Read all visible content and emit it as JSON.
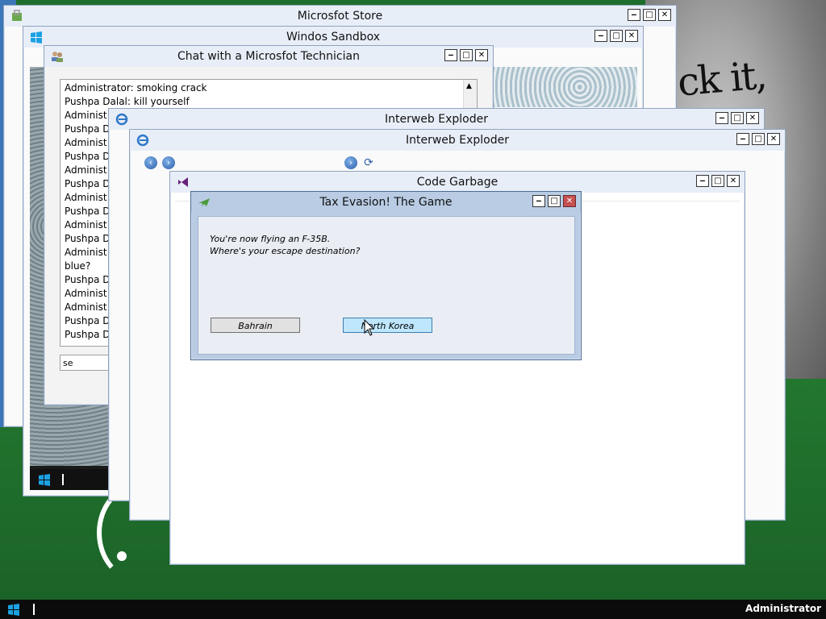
{
  "windows": {
    "store": {
      "title": "Microsfot Store"
    },
    "sandbox": {
      "title": "Windos Sandbox"
    },
    "chat": {
      "title": "Chat with a Microsfot Technician",
      "messages": [
        "Administrator: smoking crack",
        "Pushpa Dalal: kill yourself",
        "Administ",
        "Pushpa D",
        "Administ",
        "Pushpa D",
        "Administ",
        "Pushpa D",
        "Administ",
        "Pushpa D",
        "Administ",
        "Pushpa D",
        "Administ",
        "blue?",
        "Pushpa D",
        "Administ",
        "Administ",
        "Pushpa D",
        "Pushpa D"
      ],
      "input_value": "se"
    },
    "ie_back": {
      "title": "Interweb Exploder"
    },
    "ie_front": {
      "title": "Interweb Exploder"
    },
    "code": {
      "title": "Code Garbage"
    },
    "tax": {
      "title": "Tax Evasion! The Game",
      "message_line1": "You're now flying an F-35B.",
      "message_line2": "Where's your escape destination?",
      "option1": "Bahrain",
      "option2": "North Korea"
    }
  },
  "desktop": {
    "wallpaper_text": "ck it,"
  },
  "taskbar": {
    "user": "Administrator"
  },
  "colors": {
    "title_bar": "#e8eef8",
    "dialog": "#b9cce4",
    "hover_button": "#bee6fd",
    "desktop_green": "#1f6b2a"
  }
}
